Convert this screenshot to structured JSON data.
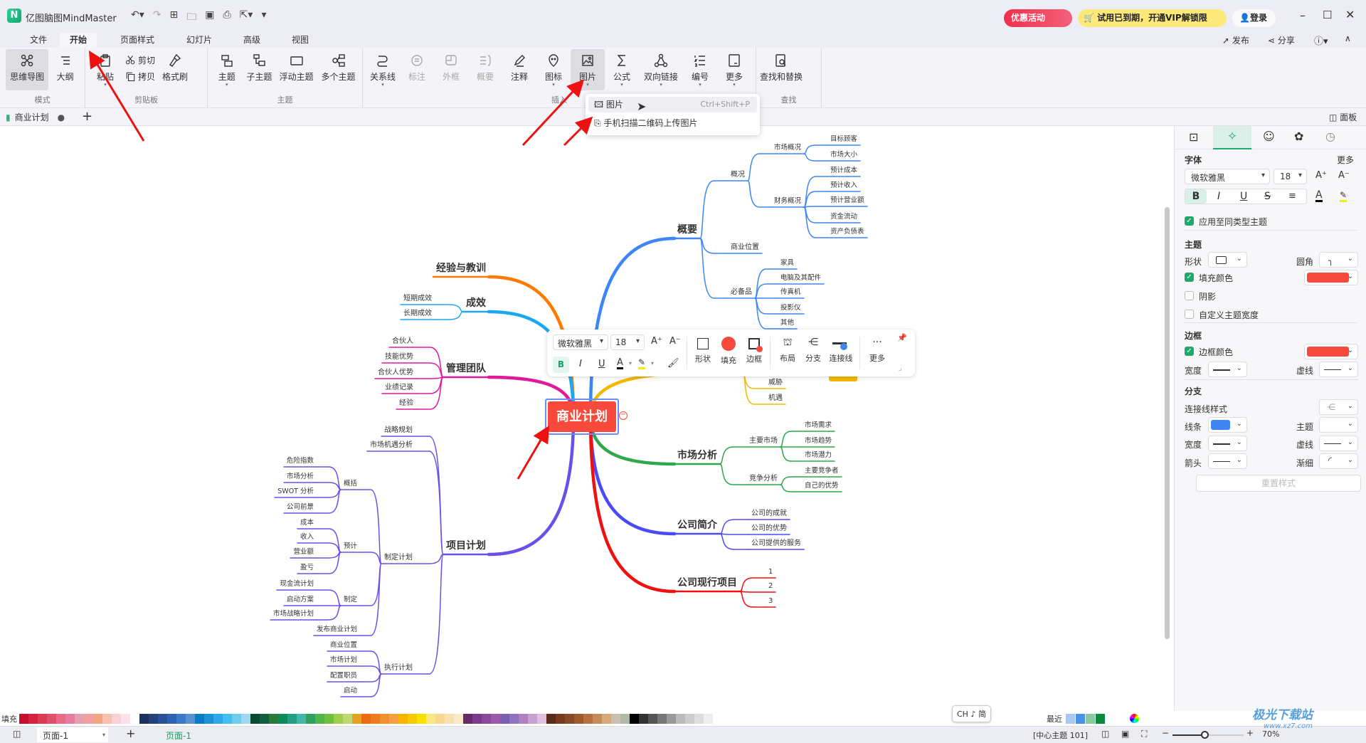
{
  "app": {
    "title": "亿图脑图MindMaster",
    "promo": "优惠活动",
    "vip": "试用已到期，开通VIP解锁限制。",
    "login": "登录",
    "publish": "发布",
    "share": "分享"
  },
  "menu": {
    "tabs": [
      "文件",
      "开始",
      "页面样式",
      "幻灯片",
      "高级",
      "视图"
    ],
    "selected": "开始"
  },
  "ribbon": {
    "groups": [
      {
        "label": "模式",
        "items": [
          {
            "label": "思维导图",
            "icon": "mindmap-icon",
            "selected": true
          },
          {
            "label": "大纲",
            "icon": "outline-icon"
          }
        ]
      },
      {
        "label": "剪贴板",
        "items": [
          {
            "label": "粘贴",
            "icon": "paste-icon",
            "caret": true
          }
        ],
        "stack": [
          {
            "label": "剪切",
            "icon": "cut-icon"
          },
          {
            "label": "拷贝",
            "icon": "copy-icon"
          }
        ],
        "after": [
          {
            "label": "格式刷",
            "icon": "format-painter-icon"
          }
        ]
      },
      {
        "label": "主题",
        "items": [
          {
            "label": "主题",
            "icon": "topic-icon",
            "caret": true
          },
          {
            "label": "子主题",
            "icon": "subtopic-icon"
          },
          {
            "label": "浮动主题",
            "icon": "floating-topic-icon"
          },
          {
            "label": "多个主题",
            "icon": "multiple-topics-icon"
          }
        ]
      },
      {
        "label": "插入",
        "items": [
          {
            "label": "关系线",
            "icon": "relationship-icon",
            "caret": true
          },
          {
            "label": "标注",
            "icon": "callout-icon",
            "disabled": true
          },
          {
            "label": "外框",
            "icon": "boundary-icon",
            "disabled": true
          },
          {
            "label": "概要",
            "icon": "summary-icon",
            "disabled": true
          },
          {
            "label": "注释",
            "icon": "note-icon"
          },
          {
            "label": "图标",
            "icon": "mark-icon",
            "caret": true
          },
          {
            "label": "图片",
            "icon": "image-icon",
            "caret": true,
            "selected": true
          },
          {
            "label": "公式",
            "icon": "formula-icon",
            "caret": true
          },
          {
            "label": "双向链接",
            "icon": "link-icon",
            "caret": true
          },
          {
            "label": "编号",
            "icon": "numbering-icon",
            "caret": true
          },
          {
            "label": "更多",
            "icon": "more-icon",
            "caret": true
          }
        ]
      },
      {
        "label": "查找",
        "items": [
          {
            "label": "查找和替换",
            "icon": "find-replace-icon"
          }
        ]
      }
    ]
  },
  "dropdown": {
    "items": [
      {
        "label": "图片",
        "shortcut": "Ctrl+Shift+P"
      },
      {
        "label": "手机扫描二维码上传图片"
      }
    ]
  },
  "doc_tab": {
    "label": "商业计划",
    "panel_label": "面板"
  },
  "float_toolbar": {
    "font": "微软雅黑",
    "size": "18",
    "shape": "形状",
    "fill": "填充",
    "border": "边框",
    "layout": "布局",
    "branch": "分支",
    "connector": "连接线",
    "more": "更多",
    "fill_color": "#f84a3c"
  },
  "panel": {
    "font_section": "字体",
    "more": "更多",
    "font": "微软雅黑",
    "size": "18",
    "apply_same": "应用至同类型主题",
    "topic_section": "主题",
    "shape": "形状",
    "corner": "圆角",
    "fill_color": "填充颜色",
    "shadow": "阴影",
    "custom_width": "自定义主题宽度",
    "border_section": "边框",
    "border_color": "边框颜色",
    "width": "宽度",
    "dash": "虚线",
    "branch_section": "分支",
    "connector_style": "连接线样式",
    "line": "线条",
    "topic": "主题",
    "arrow": "箭头",
    "taper": "渐细",
    "reset": "重置样式",
    "fill_hex": "#f84a3c",
    "border_hex": "#f84a3c",
    "line_hex": "#3f86f0",
    "checks": {
      "apply_same": true,
      "fill_color": true,
      "shadow": false,
      "custom_width": false,
      "border_color": true
    }
  },
  "mindmap": {
    "central": "商业计划",
    "central_color": "#f84a3c",
    "branches": [
      {
        "label": "概要",
        "color": "#3d86f5",
        "children": [
          {
            "label": "概况",
            "children": [
              {
                "label": "市场概况",
                "children": [
                  {
                    "label": "目标顾客"
                  },
                  {
                    "label": "市场大小"
                  }
                ]
              },
              {
                "label": "财务概况",
                "children": [
                  {
                    "label": "预计成本"
                  },
                  {
                    "label": "预计收入"
                  },
                  {
                    "label": "预计营业额"
                  },
                  {
                    "label": "资金流动"
                  },
                  {
                    "label": "资产负债表"
                  }
                ]
              }
            ]
          },
          {
            "label": "商业位置"
          },
          {
            "label": "必备品",
            "children": [
              {
                "label": "家具"
              },
              {
                "label": "电脑及其配件"
              },
              {
                "label": "传真机"
              },
              {
                "label": "投影仪"
              },
              {
                "label": "其他"
              }
            ]
          }
        ]
      },
      {
        "label": "",
        "color": "#f5b800",
        "children": [
          {
            "label": "威胁"
          },
          {
            "label": "机遇"
          }
        ]
      },
      {
        "label": "市场分析",
        "color": "#2ea84a",
        "children": [
          {
            "label": "主要市场",
            "children": [
              {
                "label": "市场需求"
              },
              {
                "label": "市场趋势"
              },
              {
                "label": "市场潜力"
              }
            ]
          },
          {
            "label": "竞争分析",
            "children": [
              {
                "label": "主要竞争者"
              },
              {
                "label": "自己的优势"
              }
            ]
          }
        ]
      },
      {
        "label": "公司简介",
        "color": "#4b4bf5",
        "children": [
          {
            "label": "公司的成就"
          },
          {
            "label": "公司的优势"
          },
          {
            "label": "公司提供的服务"
          }
        ]
      },
      {
        "label": "公司现行项目",
        "color": "#f01010",
        "children": [
          {
            "label": "1"
          },
          {
            "label": "2"
          },
          {
            "label": "3"
          }
        ]
      },
      {
        "label": "经验与教训",
        "color": "#ff7a00"
      },
      {
        "label": "成效",
        "color": "#1aa8f5",
        "children": [
          {
            "label": "短期成效"
          },
          {
            "label": "长期成效"
          }
        ]
      },
      {
        "label": "管理团队",
        "color": "#e0189a",
        "children": [
          {
            "label": "合伙人"
          },
          {
            "label": "技能优势"
          },
          {
            "label": "合伙人优势"
          },
          {
            "label": "业绩记录"
          },
          {
            "label": "经验"
          }
        ]
      },
      {
        "label": "项目计划",
        "color": "#6b4fe8",
        "children": [
          {
            "label": "战略规划"
          },
          {
            "label": "市场机遇分析"
          },
          {
            "label": "制定计划",
            "children": [
              {
                "label": "概括",
                "children": [
                  {
                    "label": "危险指数"
                  },
                  {
                    "label": "市场分析"
                  },
                  {
                    "label": "SWOT 分析"
                  },
                  {
                    "label": "公司前景"
                  }
                ]
              },
              {
                "label": "预计",
                "children": [
                  {
                    "label": "成本"
                  },
                  {
                    "label": "收入"
                  },
                  {
                    "label": "营业额"
                  },
                  {
                    "label": "盈亏"
                  }
                ]
              },
              {
                "label": "制定",
                "children": [
                  {
                    "label": "现金流计划"
                  },
                  {
                    "label": "启动方案"
                  },
                  {
                    "label": "市场战略计划"
                  }
                ]
              },
              {
                "label": "发布商业计划"
              }
            ]
          },
          {
            "label": "执行计划",
            "children": [
              {
                "label": "商业位置"
              },
              {
                "label": "市场计划"
              },
              {
                "label": "配置职员"
              },
              {
                "label": "启动"
              }
            ]
          }
        ]
      }
    ]
  },
  "colorbar": {
    "label": "填充",
    "recent_label": "最近",
    "ime": "CH ♪ 简",
    "colors": [
      "#c8102e",
      "#d6203c",
      "#dc3a52",
      "#e0506a",
      "#e86a88",
      "#e87ca0",
      "#e3a0b0",
      "#f0a0a0",
      "#f4a582",
      "#f7c0b0",
      "#f8d0d8",
      "#fde0ea",
      "#ffffff",
      "#1f2f5f",
      "#24417a",
      "#2a5298",
      "#2f62b0",
      "#3a78c8",
      "#5a8fd0",
      "#0a7cc4",
      "#1e90d8",
      "#2ea8e6",
      "#40c0f0",
      "#70ccee",
      "#a0d8f0",
      "#0a4a30",
      "#0f6040",
      "#2a7a3a",
      "#0d8a5a",
      "#20a080",
      "#40b8a8",
      "#30a060",
      "#50b848",
      "#70c040",
      "#a0cc50",
      "#c0d870",
      "#e8a020",
      "#ee6a10",
      "#f07a20",
      "#f29030",
      "#f4a040",
      "#f8b400",
      "#f8c800",
      "#f8e000",
      "#f8e880",
      "#f8d890",
      "#f8e0b0",
      "#fae8c8",
      "#6a2a6a",
      "#7a3a8a",
      "#8a4a9a",
      "#9a5aaa",
      "#7a60b0",
      "#9070c0",
      "#b080c0",
      "#c8a0d0",
      "#e0c0e0",
      "#5a2a1a",
      "#7a3a20",
      "#8a4a2a",
      "#a05a30",
      "#b87040",
      "#c88a58",
      "#d8a878",
      "#c8c0b0",
      "#b0b8a8",
      "#000000",
      "#333333",
      "#555555",
      "#777777",
      "#999999",
      "#bbbbbb",
      "#cccccc",
      "#dddddd",
      "#eeeeee"
    ],
    "recent": [
      "#a8c8f0",
      "#4a90e8",
      "#8ac8a0",
      "#0a8a3a"
    ]
  },
  "status": {
    "page_select": "页面-1",
    "page_tab": "页面-1",
    "center_topic": "[中心主题 101]",
    "zoom": "70%",
    "zoom_level": 0.45
  },
  "watermark": "极光下载站 www.xz7.com"
}
